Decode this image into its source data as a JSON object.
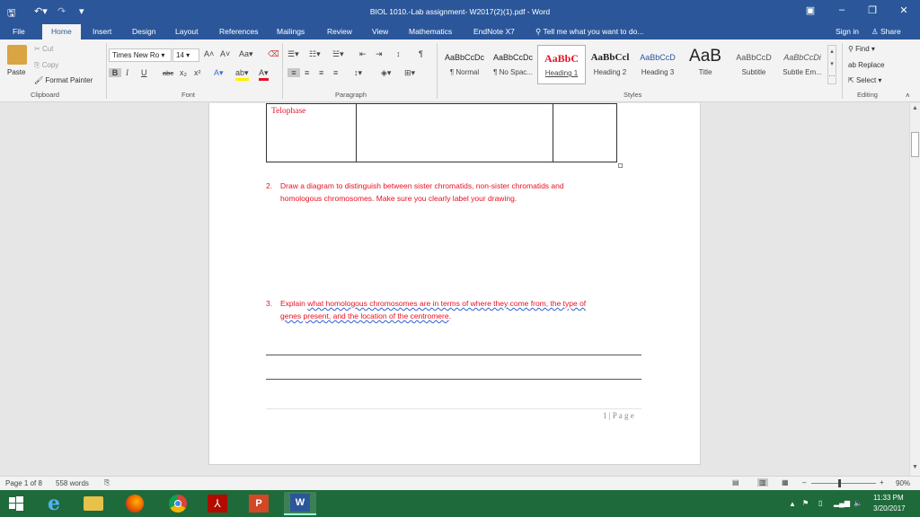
{
  "window": {
    "title": "BIOL 1010.-Lab assignment- W2017(2)(1).pdf - Word",
    "qa_save_icon": "save-icon",
    "qa_undo_icon": "undo-icon",
    "qa_redo_icon": "redo-icon"
  },
  "tabs": [
    "File",
    "Home",
    "Insert",
    "Design",
    "Layout",
    "References",
    "Mailings",
    "Review",
    "View",
    "Mathematics",
    "EndNote X7"
  ],
  "tell_me": "Tell me what you want to do...",
  "sign_in": "Sign in",
  "share": "Share",
  "clipboard": {
    "paste": "Paste",
    "cut": "Cut",
    "copy": "Copy",
    "format_painter": "Format Painter",
    "group": "Clipboard"
  },
  "font": {
    "name": "Times New Ro",
    "size": "14",
    "group": "Font",
    "aa": "Aa",
    "bold": "B",
    "italic": "I",
    "underline": "U",
    "strike": "abc",
    "sub": "x₂",
    "sup": "x²"
  },
  "paragraph": {
    "group": "Paragraph",
    "pilcrow": "¶"
  },
  "styles": {
    "group": "Styles",
    "items": [
      {
        "preview": "AaBbCcDc",
        "name": "¶ Normal"
      },
      {
        "preview": "AaBbCcDc",
        "name": "¶ No Spac..."
      },
      {
        "preview": "AaBbC",
        "name": "Heading 1"
      },
      {
        "preview": "AaBbCcl",
        "name": "Heading 2"
      },
      {
        "preview": "AaBbCcD",
        "name": "Heading 3"
      },
      {
        "preview": "AaB",
        "name": "Title"
      },
      {
        "preview": "AaBbCcD",
        "name": "Subtitle"
      },
      {
        "preview": "AaBbCcDi",
        "name": "Subtle Em..."
      }
    ]
  },
  "editing": {
    "find": "Find",
    "replace": "Replace",
    "select": "Select",
    "group": "Editing"
  },
  "document": {
    "table_cell": "Telophase",
    "q2_num": "2.",
    "q2_line1": "Draw a diagram to distinguish between sister chromatids, non-sister chromatids and",
    "q2_line2": "homologous chromosomes. Make sure you clearly label your drawing.",
    "q3_num": "3.",
    "q3_lead": "Explain ",
    "q3_line1_rest": "what homologous chromosomes are in terms of where they come from, the type of",
    "q3_line2": "genes present, and the location of the centromere",
    "q3_end": ".",
    "page_footer": "1 | P a g e"
  },
  "status": {
    "page": "Page 1 of 8",
    "words": "558 words",
    "zoom": "90%"
  },
  "taskbar": {
    "time": "11:33 PM",
    "date": "3/20/2017"
  },
  "colors": {
    "accent": "#2b579a",
    "question_text": "#e81123",
    "taskbar": "#1f6a3a"
  }
}
